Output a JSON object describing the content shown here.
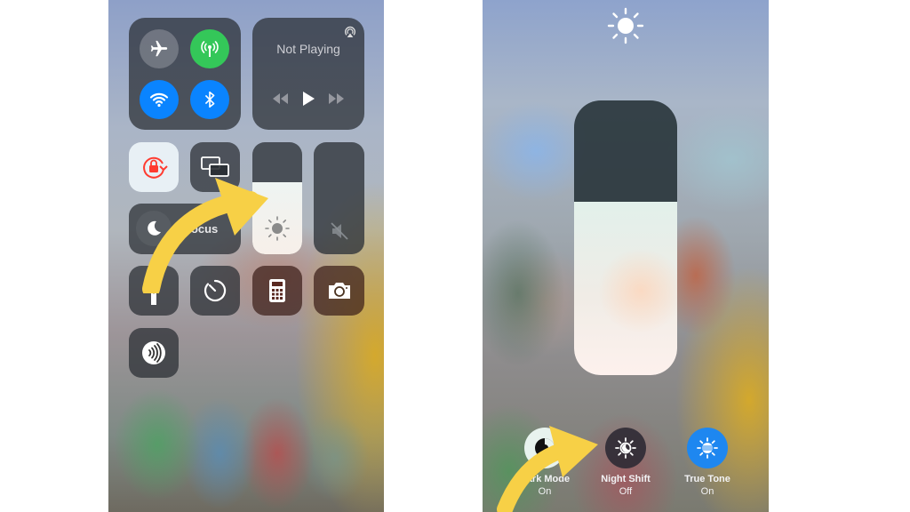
{
  "left_screen": {
    "connectivity": {
      "airplane_mode": {
        "icon": "airplane-icon",
        "state": "off"
      },
      "cellular_data": {
        "icon": "antenna-icon",
        "state": "on",
        "color": "#34c759"
      },
      "wifi": {
        "icon": "wifi-icon",
        "state": "on",
        "color": "#0a84ff"
      },
      "bluetooth": {
        "icon": "bluetooth-icon",
        "state": "on",
        "color": "#0a84ff"
      }
    },
    "now_playing": {
      "title": "Not Playing",
      "icons": [
        "airplay-icon",
        "rewind-icon",
        "play-icon",
        "fast-forward-icon"
      ]
    },
    "rotation_lock": {
      "icon": "rotation-lock-icon",
      "state": "on",
      "color": "#ff3b30"
    },
    "screen_mirroring": {
      "icon": "screen-mirroring-icon"
    },
    "brightness": {
      "icon": "sun-icon",
      "level_percent": 64
    },
    "volume": {
      "icon": "speaker-muted-icon",
      "level_percent": 0
    },
    "focus": {
      "icon": "moon-icon",
      "label": "Focus"
    },
    "shortcuts": [
      {
        "name": "flashlight",
        "icon": "flashlight-icon"
      },
      {
        "name": "timer",
        "icon": "timer-icon"
      },
      {
        "name": "calculator",
        "icon": "calculator-icon"
      },
      {
        "name": "camera",
        "icon": "camera-icon"
      },
      {
        "name": "nfc-reader",
        "icon": "nfc-icon"
      }
    ]
  },
  "right_screen": {
    "header_icon": "sun-icon",
    "brightness": {
      "level_percent": 63
    },
    "display_options": [
      {
        "label": "Dark Mode",
        "state": "On",
        "icon": "dark-mode-icon"
      },
      {
        "label": "Night Shift",
        "state": "Off",
        "icon": "night-shift-icon"
      },
      {
        "label": "True Tone",
        "state": "On",
        "icon": "true-tone-icon",
        "color": "#1e87f0"
      }
    ]
  },
  "annotations": {
    "arrow_color": "#f7d046"
  }
}
